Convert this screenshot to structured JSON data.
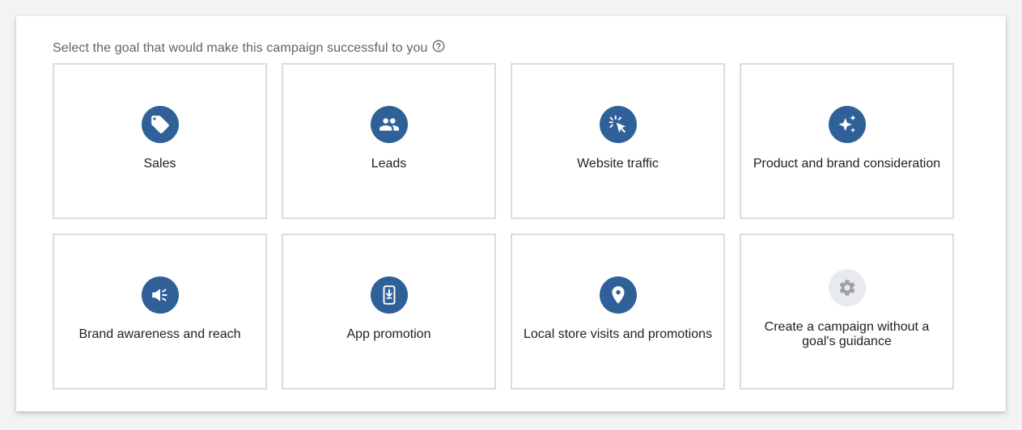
{
  "prompt": {
    "text": "Select the goal that would make this campaign successful to you",
    "help_icon": "help-circle-icon"
  },
  "colors": {
    "icon_background": "#2f6198",
    "icon_disabled_background": "#e8eaed",
    "card_border": "#dadce0",
    "prompt_text": "#5f6368",
    "label_text": "#202124"
  },
  "goals": [
    {
      "label": "Sales",
      "icon": "tag-icon"
    },
    {
      "label": "Leads",
      "icon": "people-icon"
    },
    {
      "label": "Website traffic",
      "icon": "cursor-click-icon"
    },
    {
      "label": "Product and brand consideration",
      "icon": "sparkle-icon"
    },
    {
      "label": "Brand awareness and reach",
      "icon": "megaphone-icon"
    },
    {
      "label": "App promotion",
      "icon": "phone-download-icon"
    },
    {
      "label": "Local store visits and promotions",
      "icon": "location-pin-icon"
    },
    {
      "label": "Create a campaign without a goal's guidance",
      "icon": "gear-icon"
    }
  ]
}
